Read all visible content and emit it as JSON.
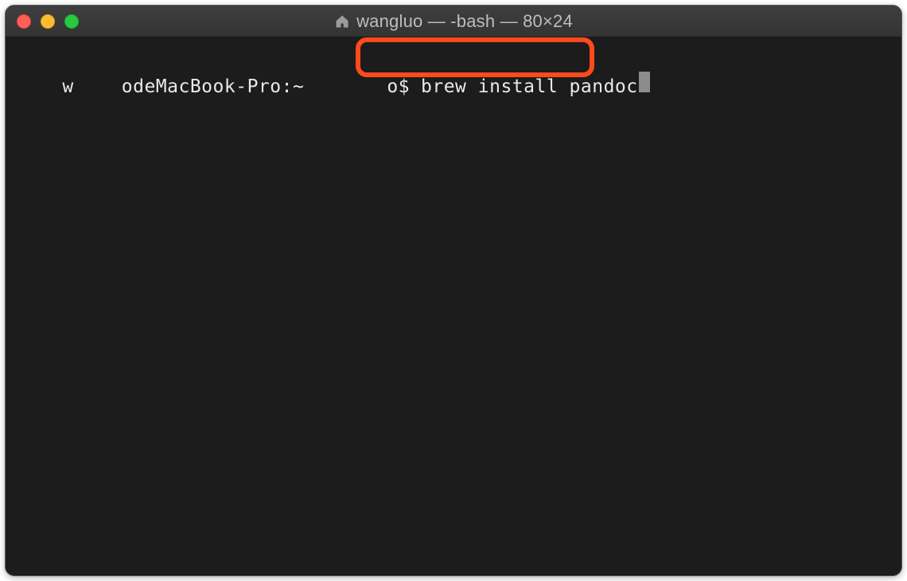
{
  "window": {
    "title": "wangluo — -bash — 80×24"
  },
  "prompt": {
    "segment_a": "w",
    "segment_b": "odeMacBook-Pro:~",
    "segment_c": "o$",
    "command": "brew install pandoc"
  },
  "colors": {
    "highlight": "#ff4a1c",
    "bg": "#1c1c1c",
    "titlebar": "#3a3a3a",
    "text": "#e9e9e9"
  },
  "icons": {
    "home": "home-icon"
  }
}
